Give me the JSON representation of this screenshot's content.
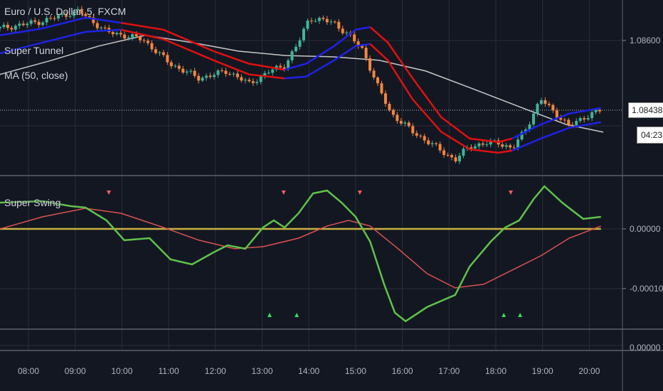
{
  "legend": {
    "symbol": "Euro / U.S. Dollar, 5, FXCM",
    "tunnel": "Super Tunnel",
    "ma": "MA (50, close)",
    "oscillator": "Super Swing"
  },
  "colors": {
    "background": "#131722",
    "grid": "#2a2e39",
    "candle_up": "#3fb59a",
    "candle_down": "#f5853f",
    "tunnel_up": "#1e22e6",
    "tunnel_down": "#e01010",
    "ma": "#c8c8c8",
    "swing_fast": "#5fc24a",
    "swing_slow": "#d9534f",
    "zero_line": "#c8b040",
    "marker_sell": "#f0605a",
    "marker_buy": "#2ee05a"
  },
  "chart_data": [
    {
      "type": "candlestick",
      "title": "Euro / U.S. Dollar, 5, FXCM",
      "xlim": [
        7.39,
        21.6
      ],
      "ylim": [
        1.08286,
        1.08694
      ],
      "y_ticks": [
        "1.08600"
      ],
      "y_tick_values": [
        1.086
      ],
      "current_price": "1.08438",
      "current_price_value": 1.08438,
      "countdown": "04:23",
      "close_path": [
        [
          7.39,
          1.08628
        ],
        [
          8.3,
          1.08645
        ],
        [
          9.07,
          1.08669
        ],
        [
          9.67,
          1.0862
        ],
        [
          10.44,
          1.08603
        ],
        [
          11.04,
          1.08545
        ],
        [
          11.65,
          1.08512
        ],
        [
          12.26,
          1.08529
        ],
        [
          12.72,
          1.08499
        ],
        [
          13.17,
          1.08529
        ],
        [
          13.48,
          1.08542
        ],
        [
          13.78,
          1.08595
        ],
        [
          14.01,
          1.08653
        ],
        [
          14.54,
          1.08641
        ],
        [
          14.85,
          1.08612
        ],
        [
          15.15,
          1.08579
        ],
        [
          15.46,
          1.08496
        ],
        [
          15.76,
          1.0843
        ],
        [
          16.22,
          1.08388
        ],
        [
          16.83,
          1.08344
        ],
        [
          17.13,
          1.08322
        ],
        [
          17.44,
          1.08355
        ],
        [
          18.05,
          1.08364
        ],
        [
          18.35,
          1.08347
        ],
        [
          18.65,
          1.08397
        ],
        [
          18.96,
          1.08463
        ],
        [
          19.26,
          1.08433
        ],
        [
          19.57,
          1.084
        ],
        [
          19.87,
          1.08421
        ],
        [
          20.25,
          1.08438
        ]
      ],
      "ma50": [
        [
          7.39,
          1.08521
        ],
        [
          8.5,
          1.08554
        ],
        [
          9.5,
          1.08587
        ],
        [
          10.5,
          1.08612
        ],
        [
          11.5,
          1.08595
        ],
        [
          12.5,
          1.08575
        ],
        [
          13.5,
          1.08565
        ],
        [
          14.5,
          1.08562
        ],
        [
          15.5,
          1.08554
        ],
        [
          16.5,
          1.08529
        ],
        [
          17.5,
          1.08488
        ],
        [
          18.5,
          1.08446
        ],
        [
          19.5,
          1.08405
        ],
        [
          20.3,
          1.08387
        ]
      ],
      "tunnel_upper": [
        [
          7.39,
          1.08612
        ],
        [
          8.3,
          1.08628
        ],
        [
          9.22,
          1.08653
        ],
        [
          9.98,
          1.08641
        ],
        [
          10.89,
          1.08625
        ],
        [
          11.96,
          1.08575
        ],
        [
          12.72,
          1.08546
        ],
        [
          13.48,
          1.08532
        ],
        [
          13.94,
          1.08546
        ],
        [
          14.54,
          1.08587
        ],
        [
          15.0,
          1.08625
        ],
        [
          15.31,
          1.08631
        ],
        [
          15.69,
          1.08595
        ],
        [
          16.22,
          1.08512
        ],
        [
          16.83,
          1.08422
        ],
        [
          17.44,
          1.08372
        ],
        [
          18.05,
          1.08364
        ],
        [
          18.35,
          1.08372
        ],
        [
          18.96,
          1.08405
        ],
        [
          19.57,
          1.0843
        ],
        [
          20.25,
          1.08443
        ]
      ],
      "tunnel_lower": [
        [
          7.39,
          1.0857
        ],
        [
          8.3,
          1.08595
        ],
        [
          9.22,
          1.0862
        ],
        [
          9.98,
          1.08625
        ],
        [
          10.89,
          1.08603
        ],
        [
          11.96,
          1.08554
        ],
        [
          12.72,
          1.08521
        ],
        [
          13.48,
          1.08512
        ],
        [
          13.94,
          1.08516
        ],
        [
          14.54,
          1.08554
        ],
        [
          15.0,
          1.08587
        ],
        [
          15.31,
          1.08592
        ],
        [
          15.69,
          1.08554
        ],
        [
          16.22,
          1.08463
        ],
        [
          16.83,
          1.08388
        ],
        [
          17.44,
          1.08347
        ],
        [
          18.05,
          1.08339
        ],
        [
          18.35,
          1.08344
        ],
        [
          18.96,
          1.08372
        ],
        [
          19.57,
          1.08397
        ],
        [
          20.25,
          1.0841
        ]
      ],
      "tunnel_trend": [
        {
          "from": 7.39,
          "to": 9.98,
          "trend": "up"
        },
        {
          "from": 9.98,
          "to": 13.48,
          "trend": "down"
        },
        {
          "from": 13.48,
          "to": 15.31,
          "trend": "up"
        },
        {
          "from": 15.31,
          "to": 18.35,
          "trend": "down"
        },
        {
          "from": 18.35,
          "to": 20.25,
          "trend": "up"
        }
      ]
    },
    {
      "type": "line",
      "title": "Super Swing",
      "ylim": [
        -0.000168,
        8.93e-05
      ],
      "y_ticks": [
        "0.00000",
        "-0.00010"
      ],
      "y_tick_values": [
        0,
        -0.0001
      ],
      "series": [
        {
          "name": "fast",
          "points": [
            [
              7.39,
              4.4e-05
            ],
            [
              8.3,
              4.64e-05
            ],
            [
              8.91,
              3.81e-05
            ],
            [
              9.22,
              3.57e-05
            ],
            [
              9.67,
              1.43e-05
            ],
            [
              10.05,
              -1.9e-05
            ],
            [
              10.59,
              -1.55e-05
            ],
            [
              11.04,
              -5.12e-05
            ],
            [
              11.5,
              -5.95e-05
            ],
            [
              11.96,
              -3.93e-05
            ],
            [
              12.26,
              -2.74e-05
            ],
            [
              12.64,
              -3.33e-05
            ],
            [
              13.02,
              2.4e-06
            ],
            [
              13.25,
              1.43e-05
            ],
            [
              13.48,
              2.4e-06
            ],
            [
              13.78,
              2.62e-05
            ],
            [
              14.09,
              5.95e-05
            ],
            [
              14.39,
              6.43e-05
            ],
            [
              14.7,
              4.4e-05
            ],
            [
              15.0,
              2.02e-05
            ],
            [
              15.31,
              -2.14e-05
            ],
            [
              15.61,
              -9.28e-05
            ],
            [
              15.84,
              -0.0001404
            ],
            [
              16.07,
              -0.0001547
            ],
            [
              16.53,
              -0.0001309
            ],
            [
              17.13,
              -0.0001107
            ],
            [
              17.44,
              -6.31e-05
            ],
            [
              17.89,
              -2.14e-05
            ],
            [
              18.2,
              2.4e-06
            ],
            [
              18.5,
              1.43e-05
            ],
            [
              18.81,
              5e-05
            ],
            [
              19.04,
              7.14e-05
            ],
            [
              19.42,
              4.4e-05
            ],
            [
              19.87,
              1.67e-05
            ],
            [
              20.25,
              2.02e-05
            ]
          ]
        },
        {
          "name": "slow",
          "points": [
            [
              7.39,
              0
            ],
            [
              8.3,
              2.02e-05
            ],
            [
              9.22,
              3.45e-05
            ],
            [
              9.98,
              2.62e-05
            ],
            [
              10.89,
              2.4e-06
            ],
            [
              11.65,
              -1.9e-05
            ],
            [
              12.41,
              -3.33e-05
            ],
            [
              13.02,
              -2.98e-05
            ],
            [
              13.78,
              -1.55e-05
            ],
            [
              14.39,
              4.8e-06
            ],
            [
              14.85,
              1.43e-05
            ],
            [
              15.31,
              4.8e-06
            ],
            [
              15.91,
              -3.33e-05
            ],
            [
              16.53,
              -7.5e-05
            ],
            [
              17.13,
              -9.88e-05
            ],
            [
              17.74,
              -9.28e-05
            ],
            [
              18.35,
              -6.9e-05
            ],
            [
              18.96,
              -4.52e-05
            ],
            [
              19.57,
              -1.55e-05
            ],
            [
              20.25,
              4.8e-06
            ]
          ]
        }
      ],
      "sell_signals": [
        9.72,
        13.46,
        15.09,
        18.32
      ],
      "buy_signals": [
        13.16,
        13.74,
        18.17,
        18.52
      ]
    },
    {
      "type": "line",
      "title": "third-pane",
      "y_ticks": [
        "0.00000"
      ]
    }
  ],
  "x_axis": {
    "ticks": [
      "08:00",
      "09:00",
      "10:00",
      "11:00",
      "12:00",
      "13:00",
      "14:00",
      "15:00",
      "16:00",
      "17:00",
      "18:00",
      "19:00",
      "20:00"
    ],
    "tick_hours": [
      8,
      9,
      10,
      11,
      12,
      13,
      14,
      15,
      16,
      17,
      18,
      19,
      20
    ]
  }
}
